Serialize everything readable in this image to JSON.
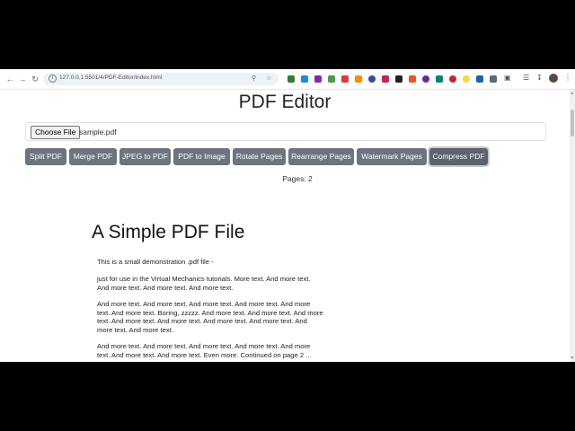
{
  "browser": {
    "url": "127.0.0.1:5501/4/PDF-Editor/index.html",
    "nav_icons": [
      "back-arrow-icon",
      "forward-arrow-icon",
      "reload-icon"
    ],
    "omnibox_icons": [
      "site-info-icon",
      "zoom-icon",
      "bookmark-star-icon"
    ]
  },
  "app": {
    "title": "PDF Editor",
    "file_input": {
      "button_label": "Choose File",
      "file_name": "sample.pdf"
    },
    "operations": [
      "Split PDF",
      "Merge PDF",
      "JPEG to PDF",
      "PDF to Image",
      "Rotate Pages",
      "Rearrange Pages",
      "Watermark Pages",
      "Compress PDF"
    ],
    "active_operation": "Compress PDF",
    "pages_label": "Pages: 2",
    "button_color": "#6c757d"
  },
  "pdf": {
    "title": "A Simple PDF File",
    "paragraphs": [
      "This is a small demonstration .pdf file -",
      "just for use in the Virtual Mechanics tutorials. More text. And more text. And more text. And more text. And more text.",
      "And more text. And more text. And more text. And more text. And more text. And more text. Boring, zzzzz. And more text. And more text. And more text. And more text. And more text. And more text. And more text. And more text. And more text.",
      "And more text. And more text. And more text. And more text. And more text. And more text. And more text. Even more. Continued on page 2 ..."
    ]
  }
}
